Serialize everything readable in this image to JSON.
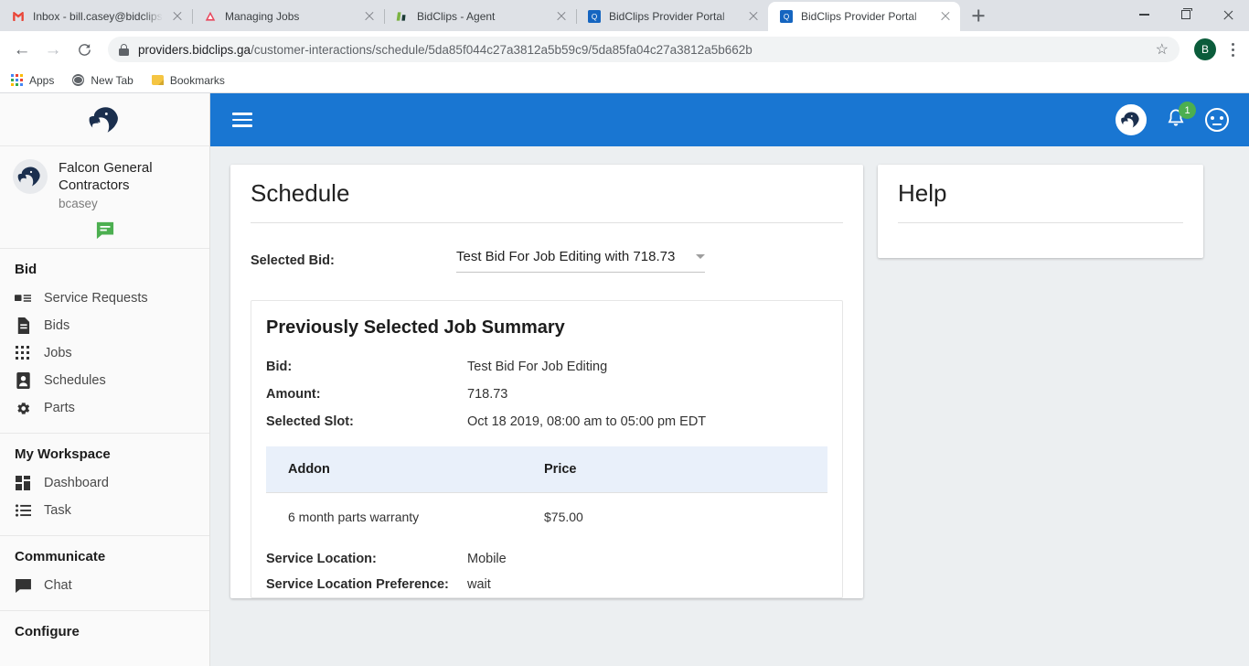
{
  "browser": {
    "tabs": [
      {
        "title": "Inbox - bill.casey@bidclips.com",
        "favicon": "gmail-icon",
        "active": false
      },
      {
        "title": "Managing Jobs",
        "favicon": "red-triangle-icon",
        "active": false
      },
      {
        "title": "BidClips - Agent",
        "favicon": "bidclips-green-icon",
        "active": false
      },
      {
        "title": "BidClips Provider Portal",
        "favicon": "bidclips-blue-icon",
        "active": false
      },
      {
        "title": "BidClips Provider Portal",
        "favicon": "bidclips-blue-icon",
        "active": true
      }
    ],
    "new_tab_label": "+",
    "window_controls": {
      "minimize": "minimize-icon",
      "maximize": "maximize-icon",
      "close": "close-icon"
    },
    "nav": {
      "back": "back-arrow-icon",
      "forward": "forward-arrow-icon",
      "reload": "reload-icon"
    },
    "omnibox": {
      "lock": "lock-icon",
      "host": "providers.bidclips.ga",
      "path": "/customer-interactions/schedule/5da85f044c27a3812a5b59c9/5da85fa04c27a3812a5b662b",
      "star": "☆"
    },
    "profile_initial": "B",
    "bookmarks": [
      {
        "label": "Apps",
        "icon": "apps-grid-icon"
      },
      {
        "label": "New Tab",
        "icon": "globe-icon"
      },
      {
        "label": "Bookmarks",
        "icon": "folder-icon"
      }
    ]
  },
  "sidebar": {
    "logo": "falcon-logo",
    "company": "Falcon General Contractors",
    "username": "bcasey",
    "chat_icon": "chat-bubble-icon",
    "groups": [
      {
        "title": "Bid",
        "items": [
          {
            "label": "Service Requests",
            "icon": "service-request-icon"
          },
          {
            "label": "Bids",
            "icon": "document-icon"
          },
          {
            "label": "Jobs",
            "icon": "grid-dots-icon"
          },
          {
            "label": "Schedules",
            "icon": "contact-card-icon"
          },
          {
            "label": "Parts",
            "icon": "gear-icon"
          }
        ]
      },
      {
        "title": "My Workspace",
        "items": [
          {
            "label": "Dashboard",
            "icon": "dashboard-icon"
          },
          {
            "label": "Task",
            "icon": "list-icon"
          }
        ]
      },
      {
        "title": "Communicate",
        "items": [
          {
            "label": "Chat",
            "icon": "chat-icon"
          }
        ]
      },
      {
        "title": "Configure",
        "items": []
      }
    ]
  },
  "appbar": {
    "menu_icon": "hamburger-menu-icon",
    "avatar": "falcon-avatar",
    "bell_icon": "bell-icon",
    "notification_count": "1",
    "account_icon": "account-face-icon",
    "color": "#1976d2"
  },
  "main": {
    "page_title": "Schedule",
    "selected_bid_label": "Selected Bid:",
    "selected_bid_value": "Test Bid For Job Editing with 718.73",
    "summary": {
      "heading": "Previously Selected Job Summary",
      "fields_top": [
        {
          "label": "Bid:",
          "value": "Test Bid For Job Editing"
        },
        {
          "label": "Amount:",
          "value": "718.73"
        },
        {
          "label": "Selected Slot:",
          "value": "Oct 18 2019, 08:00 am to 05:00 pm EDT"
        }
      ],
      "addons_table": {
        "columns": [
          "Addon",
          "Price"
        ],
        "rows": [
          {
            "addon": "6 month parts warranty",
            "price": "$75.00"
          }
        ]
      },
      "fields_bottom": [
        {
          "label": "Service Location:",
          "value": "Mobile"
        },
        {
          "label": "Service Location Preference:",
          "value": "wait"
        }
      ]
    }
  },
  "help": {
    "title": "Help"
  },
  "colors": {
    "appbar_blue": "#1976d2",
    "badge_green": "#4caf50",
    "table_header_blue": "#e9f0fa",
    "page_bg": "#eceff1",
    "chat_green": "#4caf50"
  }
}
